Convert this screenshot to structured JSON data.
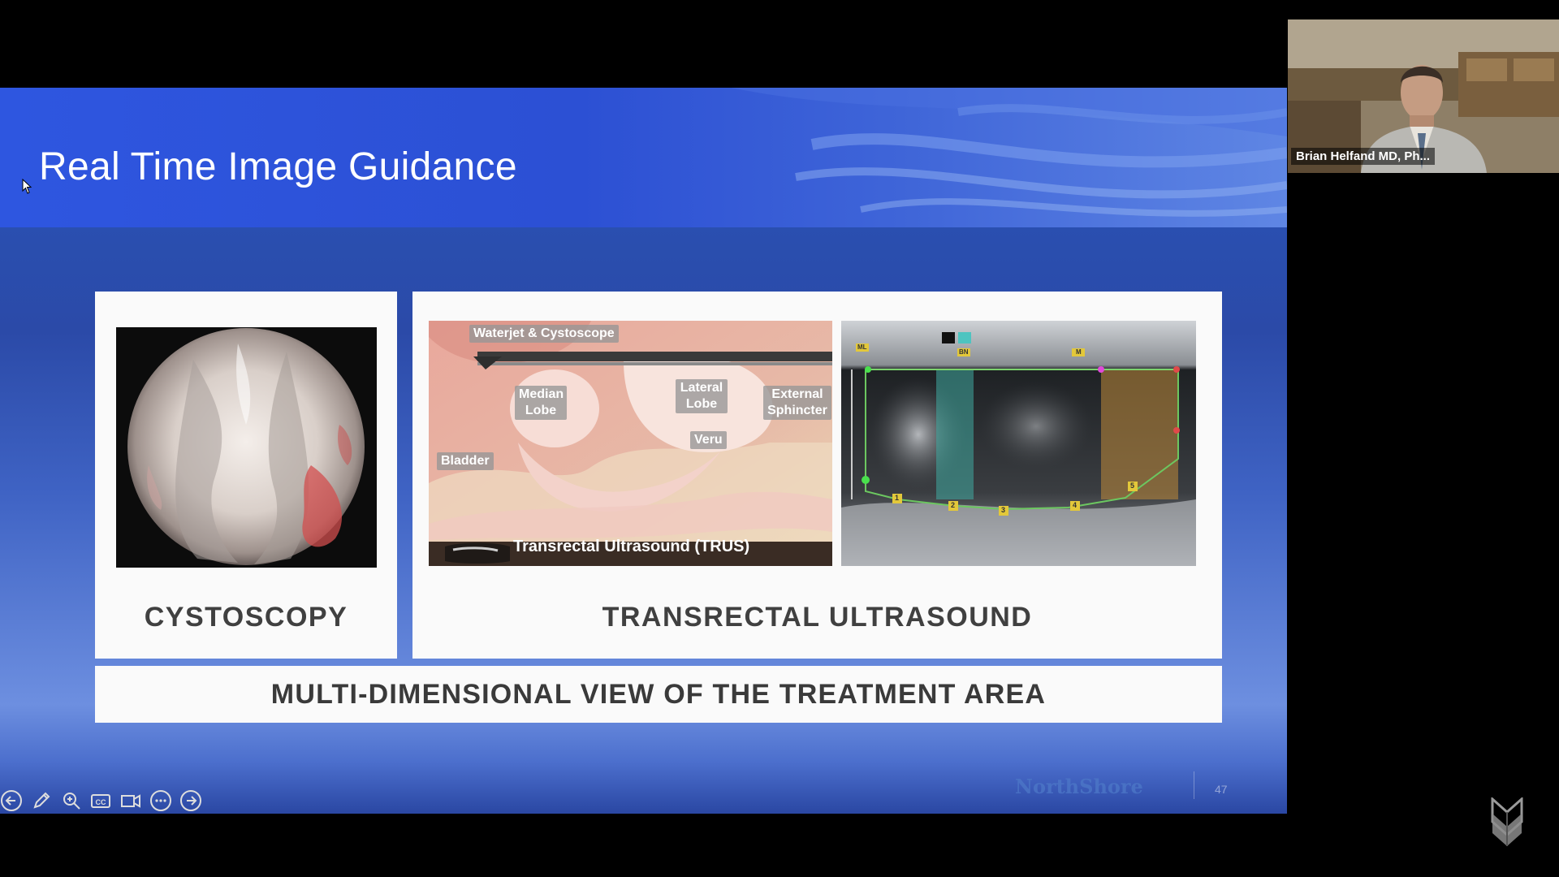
{
  "slide": {
    "title": "Real Time Image Guidance",
    "cystoscopy_caption": "CYSTOSCOPY",
    "ampersand": "&",
    "trus_caption": "TRANSRECTAL ULTRASOUND",
    "banner": "MULTI-DIMENSIONAL VIEW OF THE TREATMENT AREA",
    "logo": "NorthShore",
    "page_number": "47",
    "anatomy_labels": {
      "waterjet": "Waterjet & Cystoscope",
      "median_lobe": "Median Lobe",
      "lateral_lobe": "Lateral Lobe",
      "external_sphincter": "External Sphincter",
      "veru": "Veru",
      "bladder": "Bladder",
      "trus": "Transrectal Ultrasound (TRUS)"
    },
    "ultrasound_markers": {
      "ml": "ML",
      "bn": "BN",
      "m": "M",
      "n1": "1",
      "n2": "2",
      "n3": "3",
      "n4": "4",
      "n5": "5"
    },
    "colors": {
      "header_blue": "#2e56e0",
      "ampersand": "#3da3d6",
      "caption_text": "#404040"
    }
  },
  "presenter_controls": [
    {
      "name": "previous-slide",
      "icon": "arrow-left-circle-icon"
    },
    {
      "name": "pen",
      "icon": "pen-icon"
    },
    {
      "name": "zoom",
      "icon": "magnifier-icon"
    },
    {
      "name": "captions",
      "icon": "cc-icon"
    },
    {
      "name": "camera",
      "icon": "video-camera-icon"
    },
    {
      "name": "more",
      "icon": "ellipsis-circle-icon"
    },
    {
      "name": "next-slide",
      "icon": "arrow-right-circle-icon"
    }
  ],
  "video": {
    "participant_name": "Brian Helfand MD, Ph..."
  }
}
